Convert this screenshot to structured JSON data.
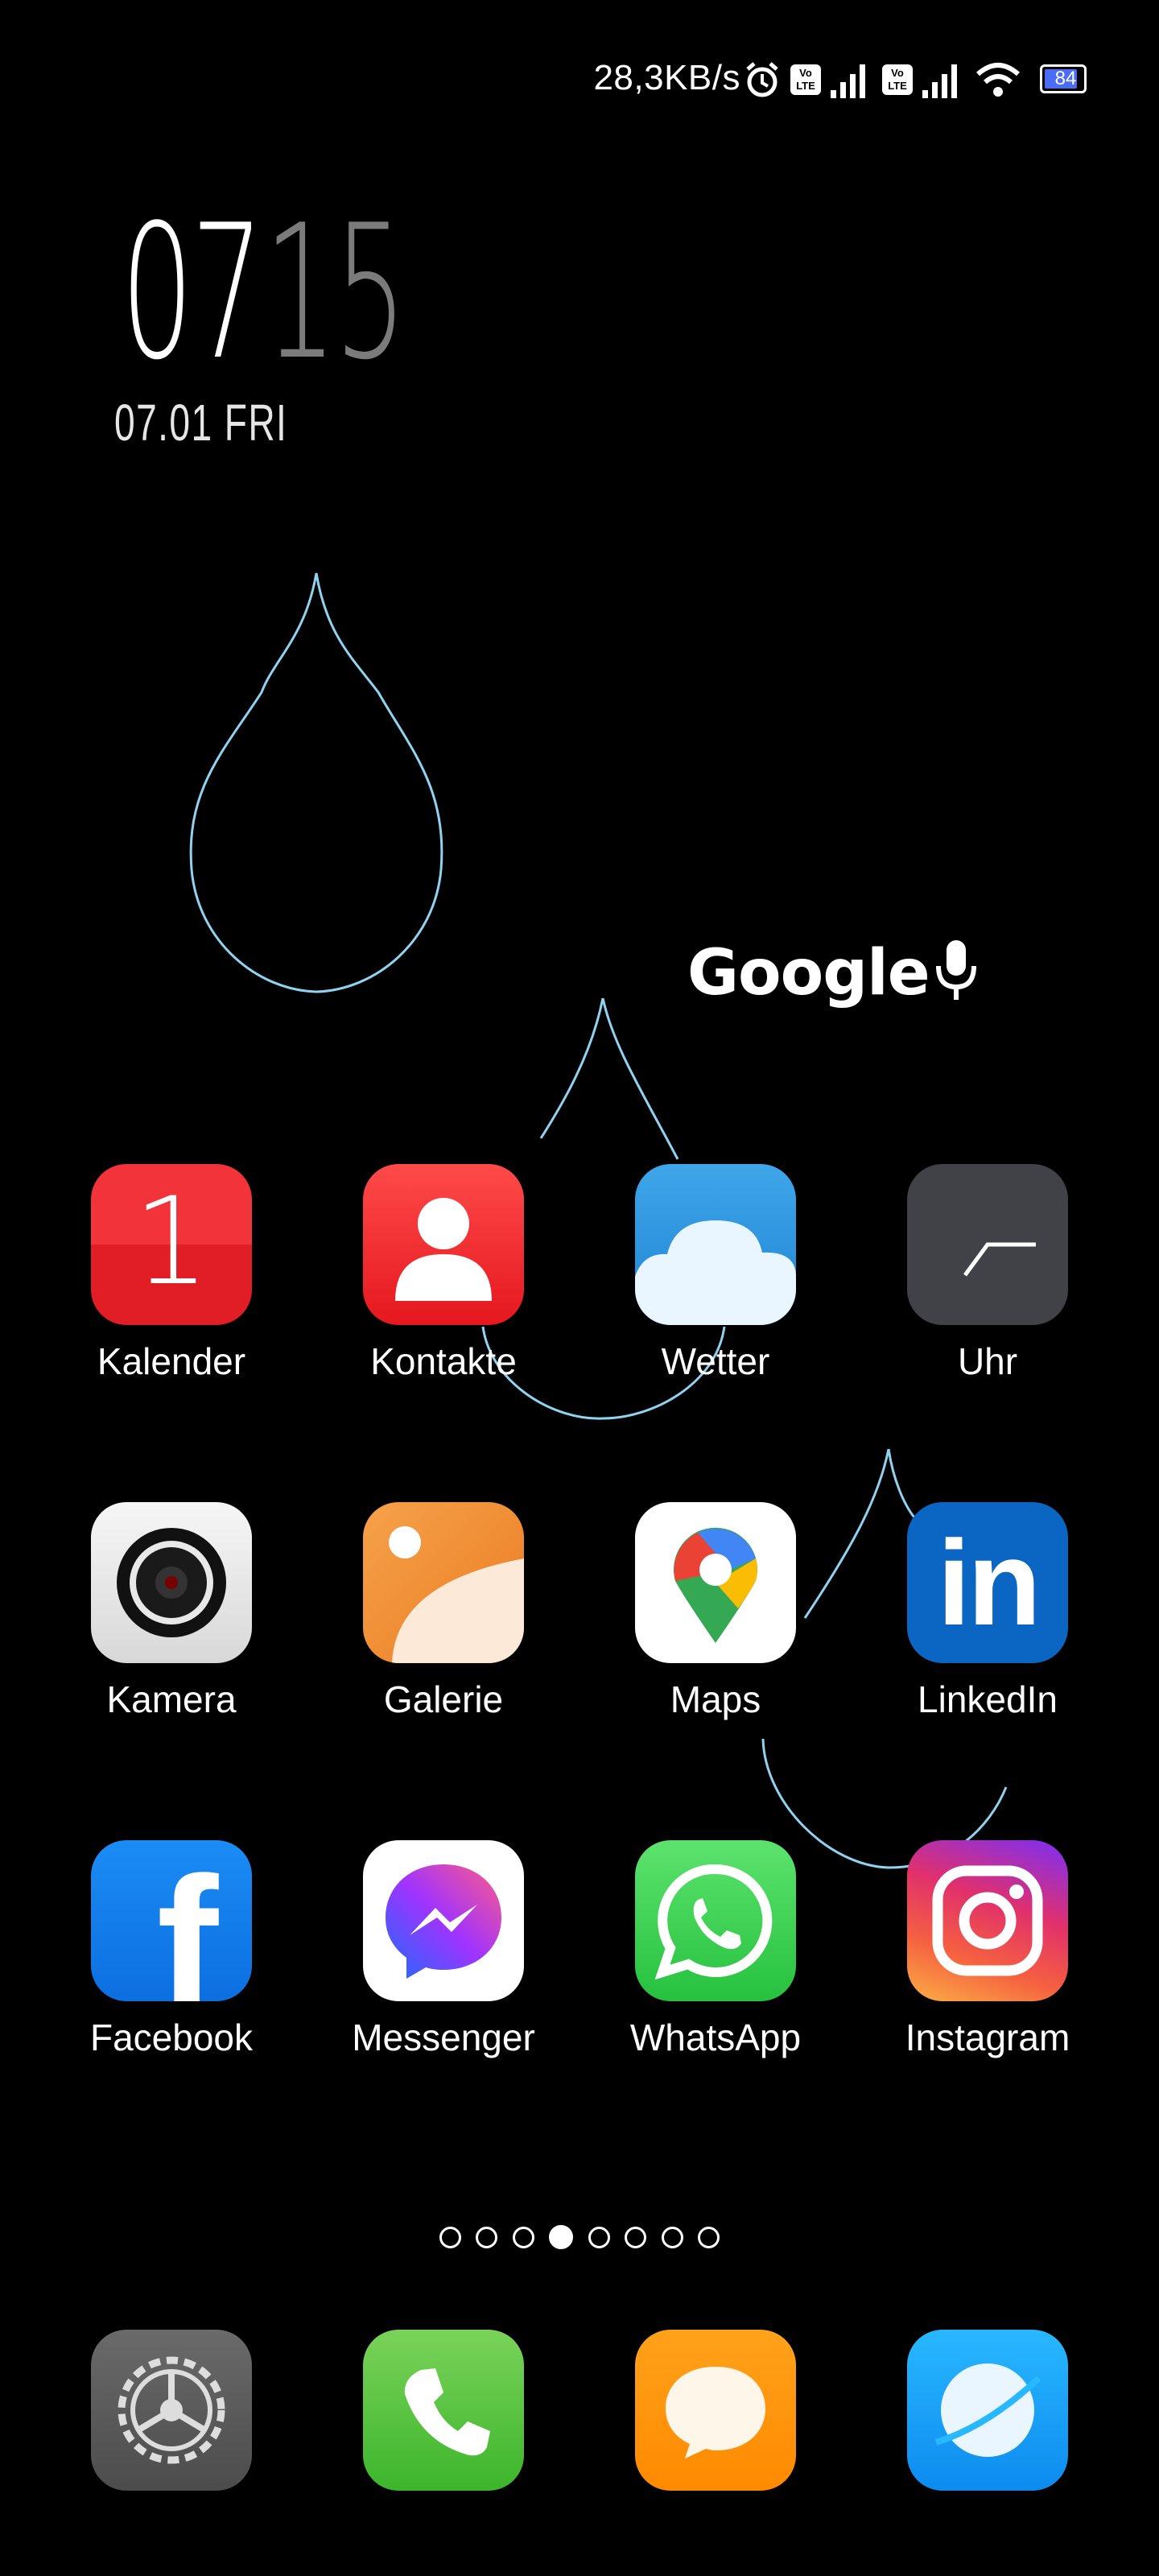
{
  "status_bar": {
    "net_speed": "28,3KB/s",
    "icons": [
      "alarm-icon",
      "volte-icon",
      "signal-icon",
      "volte-icon",
      "signal-icon",
      "wifi-icon",
      "battery-icon"
    ],
    "battery": "84",
    "volte_label": "Vo LTE"
  },
  "clock": {
    "hours": "07",
    "minutes": "15",
    "date": "07.01 FRI"
  },
  "google_widget": {
    "label": "Google"
  },
  "apps": [
    {
      "label": "Kalender",
      "icon": "calendar-icon",
      "badge_text": "1"
    },
    {
      "label": "Kontakte",
      "icon": "contacts-icon"
    },
    {
      "label": "Wetter",
      "icon": "weather-icon"
    },
    {
      "label": "Uhr",
      "icon": "clock-icon"
    },
    {
      "label": "Kamera",
      "icon": "camera-icon"
    },
    {
      "label": "Galerie",
      "icon": "gallery-icon"
    },
    {
      "label": "Maps",
      "icon": "maps-icon"
    },
    {
      "label": "LinkedIn",
      "icon": "linkedin-icon",
      "glyph": "in"
    },
    {
      "label": "Facebook",
      "icon": "facebook-icon",
      "glyph": "f"
    },
    {
      "label": "Messenger",
      "icon": "messenger-icon"
    },
    {
      "label": "WhatsApp",
      "icon": "whatsapp-icon"
    },
    {
      "label": "Instagram",
      "icon": "instagram-icon"
    }
  ],
  "page_indicator": {
    "count": 8,
    "active_index": 3
  },
  "dock": [
    {
      "icon": "settings-icon"
    },
    {
      "icon": "phone-icon"
    },
    {
      "icon": "messages-icon"
    },
    {
      "icon": "browser-icon"
    }
  ],
  "colors": {
    "background": "#000000",
    "wallpaper_line": "#8fd3f0",
    "minutes": "#7b7b7b"
  }
}
